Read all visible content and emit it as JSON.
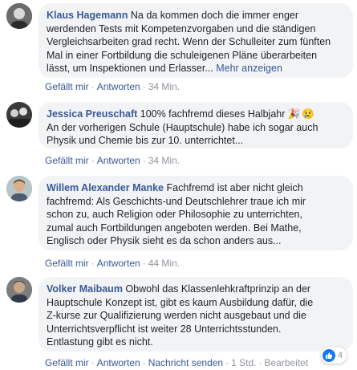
{
  "comments": [
    {
      "author": "Klaus Hagemann",
      "text": " Na da kommen doch die immer enger\nwerdenden Tests mit Kompetenzvorgaben und die ständigen\nVergleichsarbeiten grad recht. Wenn der Schulleiter zum fünften\nMal in einer Fortbildung die schuleigenen Pläne überarbeiten\nlässt, um Inspektionen und Erlasser... ",
      "more": "Mehr anzeigen",
      "like": "Gefällt mir",
      "reply": "Antworten",
      "time": "34 Min."
    },
    {
      "author": "Jessica Preuschaft",
      "text": " 100% fachfremd dieses Halbjahr ",
      "emoji1": "🎉",
      "emoji2": "😢",
      "text2": "\nAn der vorherigen Schule (Hauptschule) habe ich sogar auch\nPhysik und Chemie bis zur 10. unterrichtet...",
      "like": "Gefällt mir",
      "reply": "Antworten",
      "time": "34 Min."
    },
    {
      "author": "Willem Alexander Manke",
      "text": " Fachfremd ist aber nicht gleich\nfachfremd: Als Geschichts-und Deutschlehrer traue ich mir\nschon zu, auch Religion oder Philosophie zu unterrichten,\nzumal auch Fortbildungen angeboten werden. Bei Mathe,\nEnglisch oder Physik sieht es da schon anders aus...",
      "like": "Gefällt mir",
      "reply": "Antworten",
      "time": "44 Min."
    },
    {
      "author": "Volker Maibaum",
      "text": " Obwohl das Klassenlehkraftprinzip an der\nHauptschule Konzept ist, gibt es kaum Ausbildung dafür, die\nZ-kurse zur Qualifizierung werden nicht ausgebaut und die\nUnterrichtsverpflicht ist weiter 28 Unterrichtsstunden.\nEntlastung gibt es nicht.",
      "like": "Gefällt mir",
      "reply": "Antworten",
      "message": "Nachricht senden",
      "time": "1 Std.",
      "edited": "Bearbeitet",
      "reaction_count": "4"
    }
  ],
  "colors": {
    "link": "#385898",
    "bubble": "#f2f3f5",
    "meta": "#90949c",
    "like": "#1877f2"
  },
  "icons": {
    "reaction": "thumbs-up-icon"
  }
}
